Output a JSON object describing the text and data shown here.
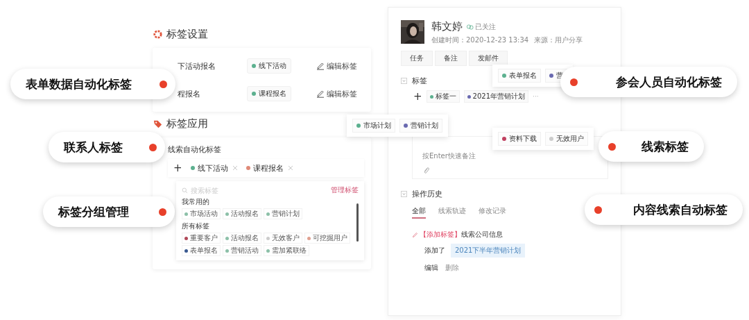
{
  "settings": {
    "title": "标签设置",
    "rows": [
      {
        "name": "下活动报名",
        "tag": {
          "label": "线下活动",
          "color": "#5cb08f"
        },
        "action": "编辑标签"
      },
      {
        "name": "程报名",
        "tag": {
          "label": "课程报名",
          "color": "#5cb08f"
        },
        "action": "编辑标签"
      }
    ]
  },
  "application": {
    "title": "标签应用",
    "field_label": "线索自动化标签",
    "add": "+",
    "selected_tags": [
      {
        "label": "线下活动",
        "color": "#5cb08f"
      },
      {
        "label": "课程报名",
        "color": "#e08a78"
      }
    ],
    "dropdown": {
      "placeholder": "搜索标签",
      "manage": "管理标签",
      "groups": [
        {
          "title": "我常用的",
          "tags": [
            {
              "label": "市场活动",
              "color": "#8cc0a8"
            },
            {
              "label": "活动报名",
              "color": "#8cc0a8"
            },
            {
              "label": "营销计划",
              "color": "#8cc0a8"
            }
          ]
        },
        {
          "title": "所有标签",
          "tags": [
            {
              "label": "重要客户",
              "color": "#b04858"
            },
            {
              "label": "活动报名",
              "color": "#8cc0a8"
            },
            {
              "label": "无效客户",
              "color": "#cccccc"
            },
            {
              "label": "可挖掘用户",
              "color": "#e0a090"
            },
            {
              "label": "表单报名",
              "color": "#3a5a90"
            },
            {
              "label": "营销活动",
              "color": "#8cc0a8"
            },
            {
              "label": "需加紧联络",
              "color": "#8cc0a8"
            }
          ]
        }
      ]
    }
  },
  "contact": {
    "name": "韩文婷",
    "follow": "已关注",
    "meta": [
      "创建时间：2020-12-23 13:34",
      "来源：用户分享"
    ],
    "actions": [
      "任务",
      "备注",
      "发邮件"
    ],
    "tags_section": {
      "title": "标签",
      "add": "+",
      "tags": [
        {
          "label": "标签一",
          "color": "#5cb08f"
        },
        {
          "label": "2021年营销计划",
          "color": "#6a6ab0"
        }
      ],
      "more": "···"
    },
    "note": {
      "placeholder": "按Enter快速备注"
    },
    "history": {
      "title": "操作历史",
      "tabs": [
        {
          "label": "全部",
          "selected": true
        },
        {
          "label": "线索轨迹",
          "selected": false
        },
        {
          "label": "修改记录",
          "selected": false
        }
      ],
      "entry": {
        "tag": "【添加标签】",
        "text": "线索公司信息",
        "added_label": "添加了",
        "value": "2021下半年营销计划",
        "actions": [
          "编辑",
          "删除"
        ]
      }
    }
  },
  "popups": [
    {
      "tags": [
        {
          "label": "表单报名",
          "color": "#5cb08f"
        },
        {
          "label": "营",
          "color": "#6a6ab0"
        }
      ]
    },
    {
      "tags": [
        {
          "label": "市场计划",
          "color": "#5cb08f"
        },
        {
          "label": "营销计划",
          "color": "#6a6ab0"
        }
      ]
    },
    {
      "tags": [
        {
          "label": "资料下载",
          "color": "#c04060"
        },
        {
          "label": "无效用户",
          "color": "#cccccc"
        }
      ]
    }
  ],
  "callouts": [
    {
      "label": "表单数据自动化标签"
    },
    {
      "label": "联系人标签"
    },
    {
      "label": "标签分组管理"
    },
    {
      "label": "参会人员自动化标签"
    },
    {
      "label": "线索标签"
    },
    {
      "label": "内容线索自动标签"
    }
  ]
}
